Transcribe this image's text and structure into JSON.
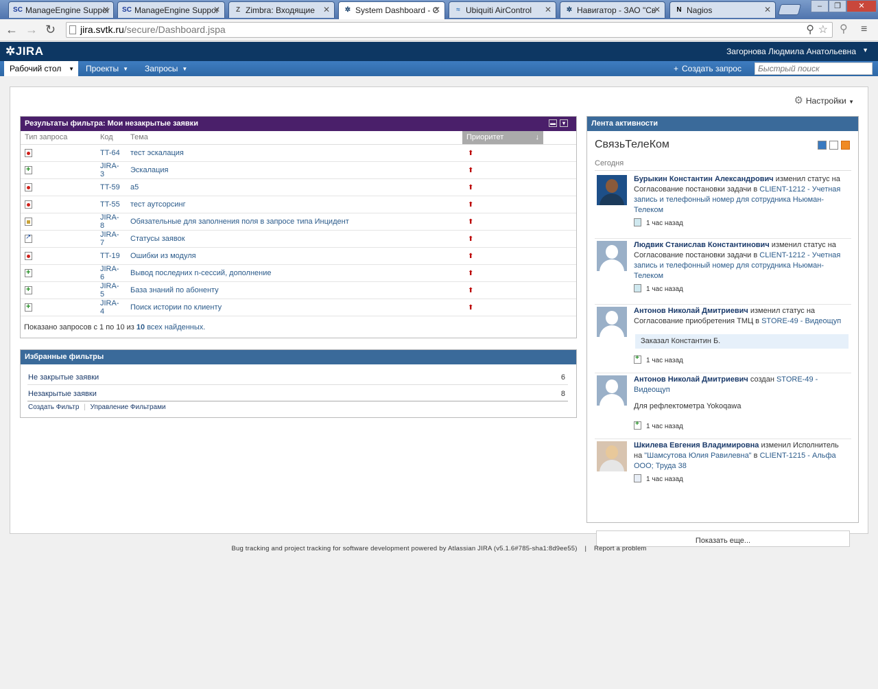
{
  "browser": {
    "tabs": [
      {
        "favicon": "SC",
        "title": "ManageEngine Suppor"
      },
      {
        "favicon": "SC",
        "title": "ManageEngine Suppor"
      },
      {
        "favicon": "Z",
        "title": "Zimbra: Входящие"
      },
      {
        "favicon": "jira-icon",
        "title": "System Dashboard - C"
      },
      {
        "favicon": "ubiquiti-icon",
        "title": "Ubiquiti AirControl"
      },
      {
        "favicon": "navigator-icon",
        "title": "Навигатор - ЗАО \"Св"
      },
      {
        "favicon": "N",
        "title": "Nagios"
      }
    ],
    "url_domain": "jira.svtk.ru",
    "url_path": "/secure/Dashboard.jspa"
  },
  "header": {
    "logo": "JIRA",
    "user": "Загорнова Людмила Анатольевна"
  },
  "nav": {
    "dashboard": "Рабочий стол",
    "projects": "Проекты",
    "issues": "Запросы",
    "create_issue": "Создать запрос",
    "quick_search_placeholder": "Быстрый поиск"
  },
  "dashboard": {
    "settings": "Настройки",
    "filter_gadget": {
      "title": "Результаты фильтра: Мои незакрытые заявки",
      "columns": {
        "type": "Тип запроса",
        "key": "Код",
        "summary": "Тема",
        "priority": "Приоритет"
      },
      "rows": [
        {
          "type": "bug",
          "key": "TT-64",
          "summary": "тест эскалация"
        },
        {
          "type": "plus",
          "key": "JIRA-3",
          "summary": "Эскалация"
        },
        {
          "type": "bug",
          "key": "TT-59",
          "summary": "а5"
        },
        {
          "type": "bug",
          "key": "TT-55",
          "summary": "тест аутсорсинг"
        },
        {
          "type": "task",
          "key": "JIRA-8",
          "summary": "Обязательные для заполнения поля в запросе типа Инцидент"
        },
        {
          "type": "arrow",
          "key": "JIRA-7",
          "summary": "Статусы заявок"
        },
        {
          "type": "bug",
          "key": "TT-19",
          "summary": "Ошибки из модуля"
        },
        {
          "type": "plus",
          "key": "JIRA-6",
          "summary": "Вывод последних n-сессий, дополнение"
        },
        {
          "type": "plus",
          "key": "JIRA-5",
          "summary": "База знаний по абоненту"
        },
        {
          "type": "plus",
          "key": "JIRA-4",
          "summary": "Поиск истории по клиенту"
        }
      ],
      "pager_prefix": "Показано запросов с 1 по 10 из",
      "pager_total": "10",
      "pager_suffix": "всех найденных."
    },
    "fav_gadget": {
      "title": "Избранные фильтры",
      "filters": [
        {
          "name": "Не закрытые заявки",
          "count": "6"
        },
        {
          "name": "Незакрытые заявки",
          "count": "8"
        }
      ],
      "create_filter": "Создать Фильтр",
      "manage_filters": "Управление Фильтрами"
    },
    "activity": {
      "title": "Лента активности",
      "stream_name": "СвязьТелеКом",
      "today": "Сегодня",
      "items": [
        {
          "user": "Бурыкин Константин Александрович",
          "text": " изменил статус на Согласование постановки задачи в ",
          "link": "CLIENT-1212 - Учетная запись и телефонный номер для сотрудника Ньюман-Телеком",
          "time": "1 час назад"
        },
        {
          "user": "Людвик Станислав Константинович",
          "text": " изменил статус на Согласование постановки задачи в ",
          "link": "CLIENT-1212 - Учетная запись и телефонный номер для сотрудника Ньюман-Телеком",
          "time": "1 час назад"
        },
        {
          "user": "Антонов Николай Дмитриевич",
          "text": " изменил статус на Согласование приобретения ТМЦ в ",
          "link": "STORE-49 - Видеощуп",
          "comment": "Заказал Константин Б.",
          "time": "1 час назад"
        },
        {
          "user": "Антонов Николай Дмитриевич",
          "text": " создан ",
          "link": "STORE-49 - Видеощуп",
          "body": "Для рефлектометра Yokoqawa",
          "time": "1 час назад"
        },
        {
          "user": "Шкилева Евгения Владимировна",
          "text": " изменил Исполнитель на ",
          "link2": "\"Шамсутова Юлия Равилевна\"",
          "text2": " в ",
          "link": "CLIENT-1215 - Альфа ООО; Труда 38",
          "time": "1 час назад"
        }
      ],
      "show_more": "Показать еще..."
    }
  },
  "footer": {
    "text": "Bug tracking and project tracking for software development powered by Atlassian JIRA (v5.1.6#785-sha1:8d9ee55)",
    "separator": "|",
    "report": "Report a problem"
  }
}
